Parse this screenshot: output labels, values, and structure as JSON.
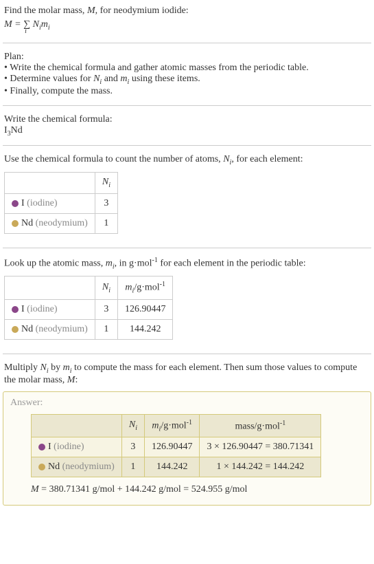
{
  "intro": {
    "line1": "Find the molar mass, ",
    "line1_var": "M",
    "line1_end": ", for neodymium iodide:",
    "formula_lhs": "M",
    "formula_eq": " = ",
    "formula_sum": "∑",
    "formula_sum_sub": "i",
    "formula_rhs1": " N",
    "formula_rhs1_sub": "i",
    "formula_rhs2": "m",
    "formula_rhs2_sub": "i"
  },
  "plan": {
    "heading": "Plan:",
    "bullet1": "• Write the chemical formula and gather atomic masses from the periodic table.",
    "bullet2_start": "• Determine values for ",
    "bullet2_n": "N",
    "bullet2_n_sub": "i",
    "bullet2_and": " and ",
    "bullet2_m": "m",
    "bullet2_m_sub": "i",
    "bullet2_end": " using these items.",
    "bullet3": "• Finally, compute the mass."
  },
  "chemformula": {
    "heading": "Write the chemical formula:",
    "formula_i": "I",
    "formula_sub": "3",
    "formula_nd": "Nd"
  },
  "count": {
    "heading_start": "Use the chemical formula to count the number of atoms, ",
    "heading_n": "N",
    "heading_n_sub": "i",
    "heading_end": ", for each element:",
    "col_n": "N",
    "col_n_sub": "i",
    "iodine_sym": "I ",
    "iodine_label": "(iodine)",
    "iodine_n": "3",
    "neodymium_sym": "Nd ",
    "neodymium_label": "(neodymium)",
    "neodymium_n": "1"
  },
  "lookup": {
    "heading_start": "Look up the atomic mass, ",
    "heading_m": "m",
    "heading_m_sub": "i",
    "heading_mid": ", in g·mol",
    "heading_sup": "-1",
    "heading_end": " for each element in the periodic table:",
    "col_n": "N",
    "col_n_sub": "i",
    "col_m": "m",
    "col_m_sub": "i",
    "col_m_unit": "/g·mol",
    "col_m_sup": "-1",
    "iodine_sym": "I ",
    "iodine_label": "(iodine)",
    "iodine_n": "3",
    "iodine_m": "126.90447",
    "neodymium_sym": "Nd ",
    "neodymium_label": "(neodymium)",
    "neodymium_n": "1",
    "neodymium_m": "144.242"
  },
  "multiply": {
    "heading_start": "Multiply ",
    "heading_n": "N",
    "heading_n_sub": "i",
    "heading_by": " by ",
    "heading_m": "m",
    "heading_m_sub": "i",
    "heading_mid": " to compute the mass for each element. Then sum those values to compute the molar mass, ",
    "heading_mvar": "M",
    "heading_end": ":"
  },
  "answer": {
    "label": "Answer:",
    "col_n": "N",
    "col_n_sub": "i",
    "col_m": "m",
    "col_m_sub": "i",
    "col_m_unit": "/g·mol",
    "col_m_sup": "-1",
    "col_mass": "mass/g·mol",
    "col_mass_sup": "-1",
    "iodine_sym": "I ",
    "iodine_label": "(iodine)",
    "iodine_n": "3",
    "iodine_m": "126.90447",
    "iodine_mass": "3 × 126.90447 = 380.71341",
    "neodymium_sym": "Nd ",
    "neodymium_label": "(neodymium)",
    "neodymium_n": "1",
    "neodymium_m": "144.242",
    "neodymium_mass": "1 × 144.242 = 144.242",
    "final_m": "M",
    "final_eq": " = 380.71341 g/mol + 144.242 g/mol = 524.955 g/mol"
  }
}
